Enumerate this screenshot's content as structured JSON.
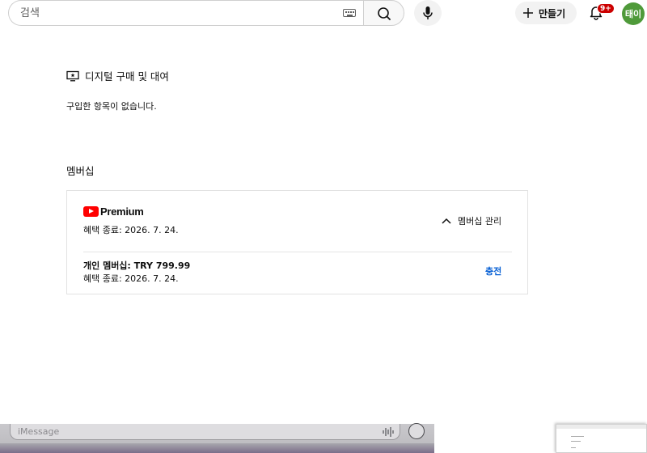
{
  "header": {
    "search_placeholder": "검색",
    "icons": [
      "keyboard-icon",
      "search-icon",
      "mic-icon",
      "plus-icon",
      "bell-icon"
    ],
    "create_label": "만들기",
    "notification_badge": "9+",
    "avatar_text": "태이",
    "avatar_color": "#4f9a3a"
  },
  "purchases": {
    "title": "디지털 구매 및 대여",
    "empty_message": "구입한 항목이 없습니다."
  },
  "membership": {
    "heading": "멤버십",
    "brand": "Premium",
    "benefit_end": "혜택 종료: 2026. 7. 24.",
    "manage_label": "멤버십 관리",
    "plan_line": "개인 멤버십: TRY 799.99",
    "benefit_end_2": "혜택 종료: 2026. 7. 24.",
    "recharge_label": "충전"
  },
  "overlay": {
    "imessage_placeholder": "iMessage"
  },
  "colors": {
    "accent_link": "#065fd4",
    "brand_red": "#ff0000",
    "badge_red": "#cc0000"
  }
}
